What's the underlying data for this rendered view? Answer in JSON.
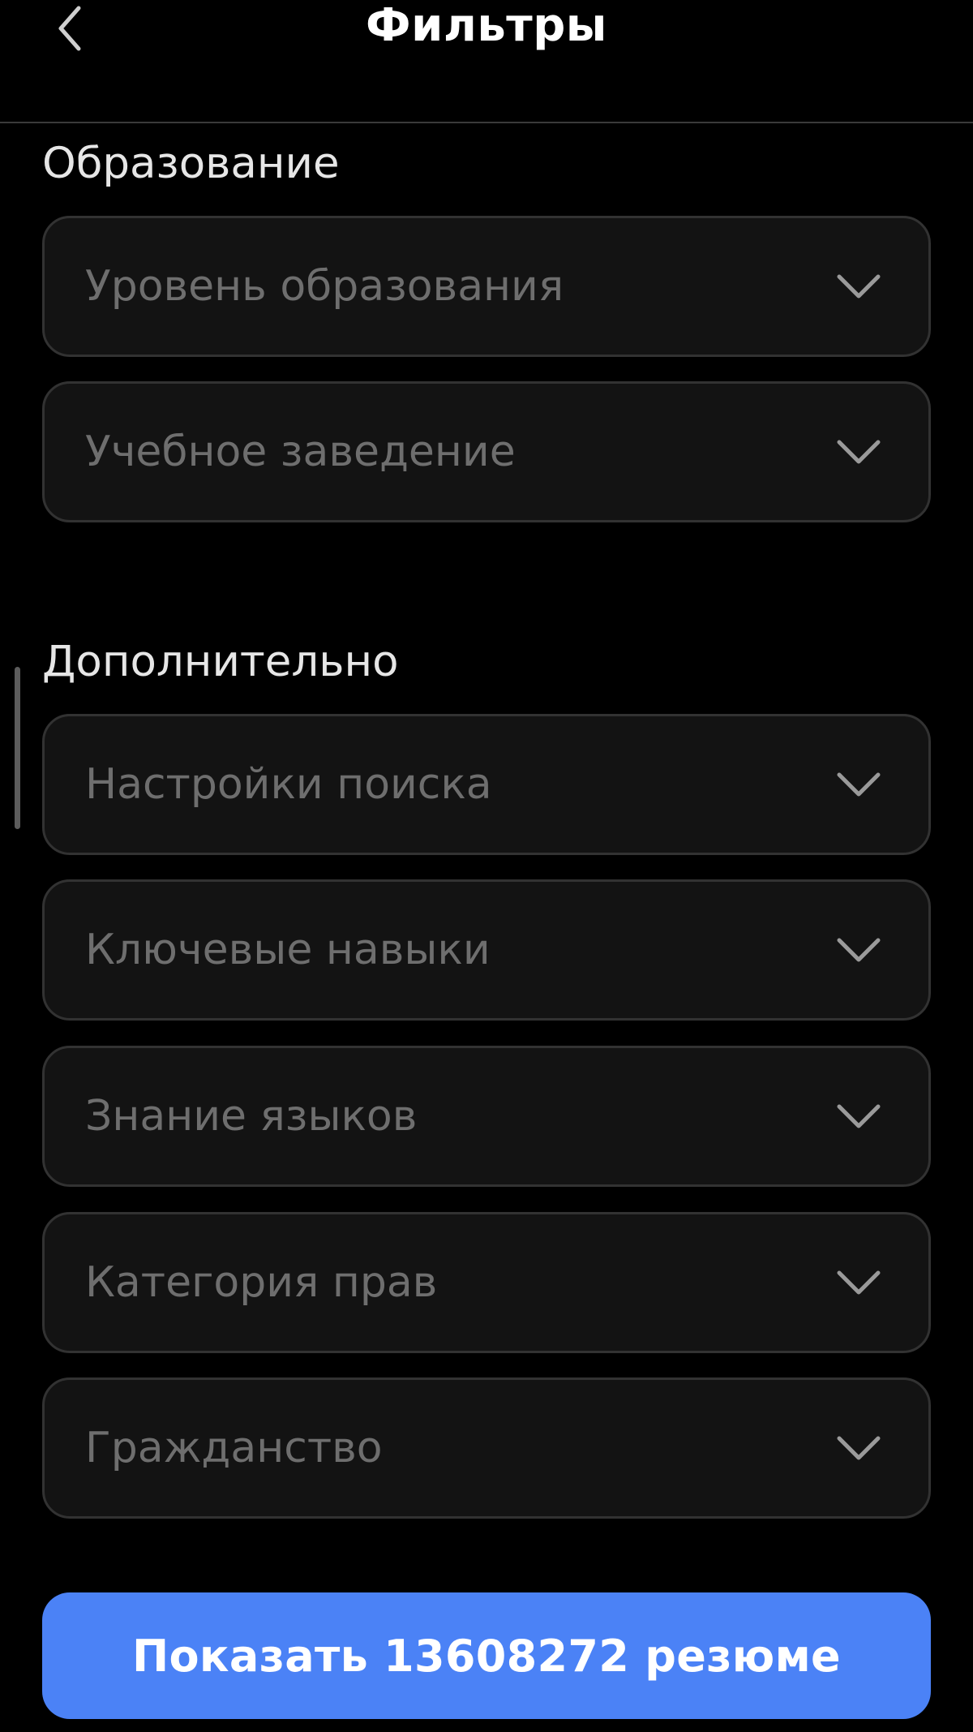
{
  "header": {
    "title": "Фильтры",
    "back_icon": "chevron-left-icon"
  },
  "sections": [
    {
      "title": "Образование",
      "fields": [
        {
          "label": "Уровень образования"
        },
        {
          "label": "Учебное заведение"
        }
      ]
    },
    {
      "title": "Дополнительно",
      "fields": [
        {
          "label": "Настройки поиска"
        },
        {
          "label": "Ключевые навыки"
        },
        {
          "label": "Знание языков"
        },
        {
          "label": "Категория прав"
        },
        {
          "label": "Гражданство"
        }
      ]
    }
  ],
  "footer": {
    "show_button_label": "Показать 13608272 резюме"
  },
  "colors": {
    "background": "#000000",
    "field_background": "#131313",
    "field_border": "#323232",
    "placeholder_text": "#6e6e6e",
    "accent": "#4b82f6"
  }
}
